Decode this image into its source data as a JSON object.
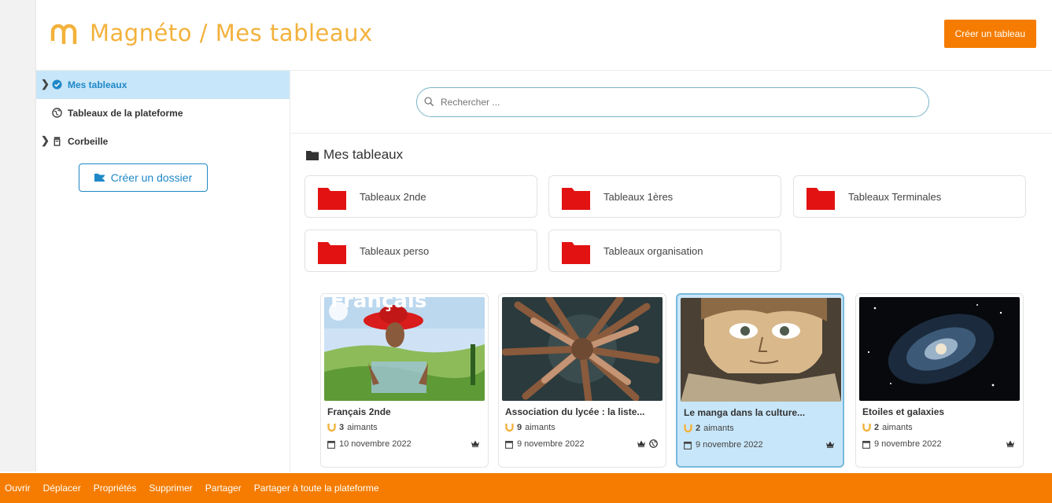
{
  "header": {
    "title": "Magnéto / Mes tableaux",
    "create_label": "Créer un tableau"
  },
  "sidebar": {
    "items": [
      {
        "label": "Mes tableaux",
        "icon": "check-circle-icon",
        "has_chevron": true,
        "active": true
      },
      {
        "label": "Tableaux de la plateforme",
        "icon": "globe-icon",
        "has_chevron": false,
        "active": false
      },
      {
        "label": "Corbeille",
        "icon": "trash-icon",
        "has_chevron": true,
        "active": false
      }
    ],
    "new_folder_label": "Créer un dossier"
  },
  "search": {
    "placeholder": "Rechercher ..."
  },
  "section": {
    "title": "Mes tableaux"
  },
  "folders": [
    {
      "label": "Tableaux 2nde"
    },
    {
      "label": "Tableaux 1ères"
    },
    {
      "label": "Tableaux Terminales"
    },
    {
      "label": "Tableaux perso"
    },
    {
      "label": "Tableaux organisation"
    }
  ],
  "boards": [
    {
      "title": "Français 2nde",
      "magnets_count": "3",
      "magnets_label": "aimants",
      "date": "10 novembre 2022",
      "icons": [
        "crown-icon"
      ],
      "thumb_cover_text": "Français"
    },
    {
      "title": "Association du lycée : la liste...",
      "magnets_count": "9",
      "magnets_label": "aimants",
      "date": "9 novembre 2022",
      "icons": [
        "crown-icon",
        "globe-icon"
      ]
    },
    {
      "title": "Le manga dans la culture...",
      "magnets_count": "2",
      "magnets_label": "aimants",
      "date": "9 novembre 2022",
      "icons": [
        "crown-icon"
      ]
    },
    {
      "title": "Etoiles et galaxies",
      "magnets_count": "2",
      "magnets_label": "aimants",
      "date": "9 novembre 2022",
      "icons": [
        "crown-icon"
      ]
    }
  ],
  "bottom_bar": {
    "actions": [
      "Ouvrir",
      "Déplacer",
      "Propriétés",
      "Supprimer",
      "Partager",
      "Partager à toute la plateforme"
    ]
  },
  "colors": {
    "brand": "#f57c00",
    "title": "#f3b23c",
    "active_bg": "#c8e6f9",
    "accent": "#1e88c8",
    "folder": "#e31212"
  }
}
